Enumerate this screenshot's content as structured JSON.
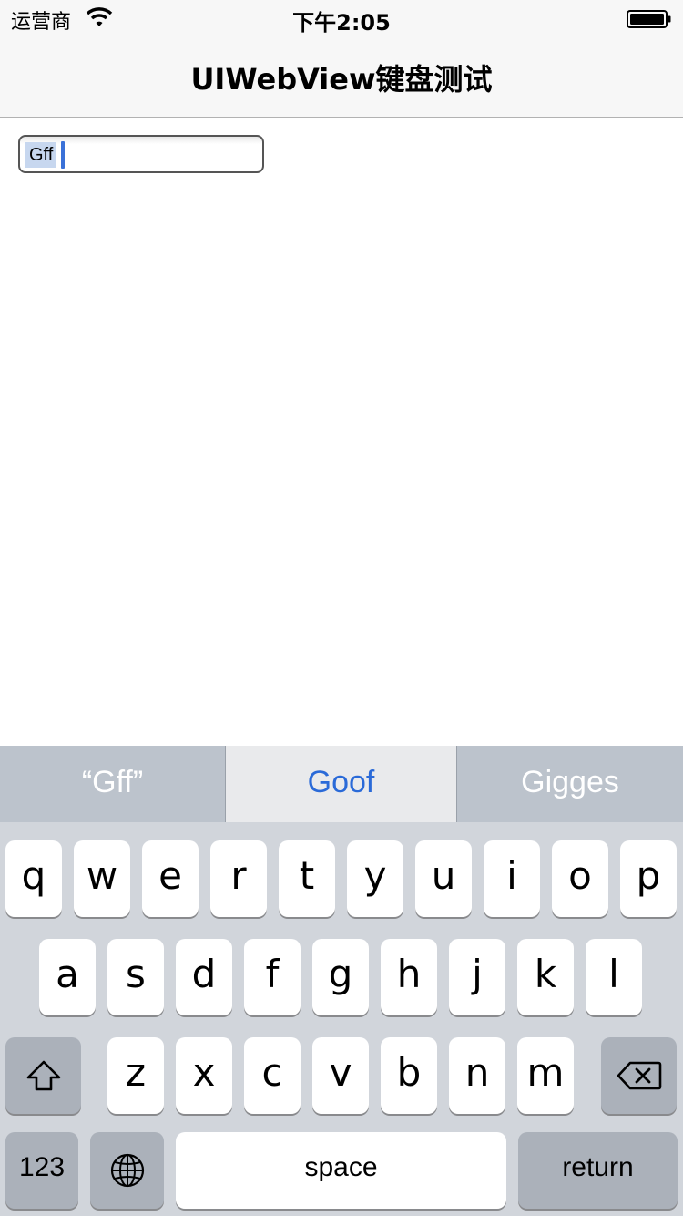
{
  "status_bar": {
    "carrier": "运营商",
    "time": "下午2:05"
  },
  "nav": {
    "title": "UIWebView键盘测试"
  },
  "page": {
    "input_value": "Gff"
  },
  "keyboard": {
    "suggestions": [
      "“Gff”",
      "Goof",
      "Gigges"
    ],
    "row1": [
      "q",
      "w",
      "e",
      "r",
      "t",
      "y",
      "u",
      "i",
      "o",
      "p"
    ],
    "row2": [
      "a",
      "s",
      "d",
      "f",
      "g",
      "h",
      "j",
      "k",
      "l"
    ],
    "row3": [
      "z",
      "x",
      "c",
      "v",
      "b",
      "n",
      "m"
    ],
    "numbers_label": "123",
    "space_label": "space",
    "return_label": "return"
  }
}
